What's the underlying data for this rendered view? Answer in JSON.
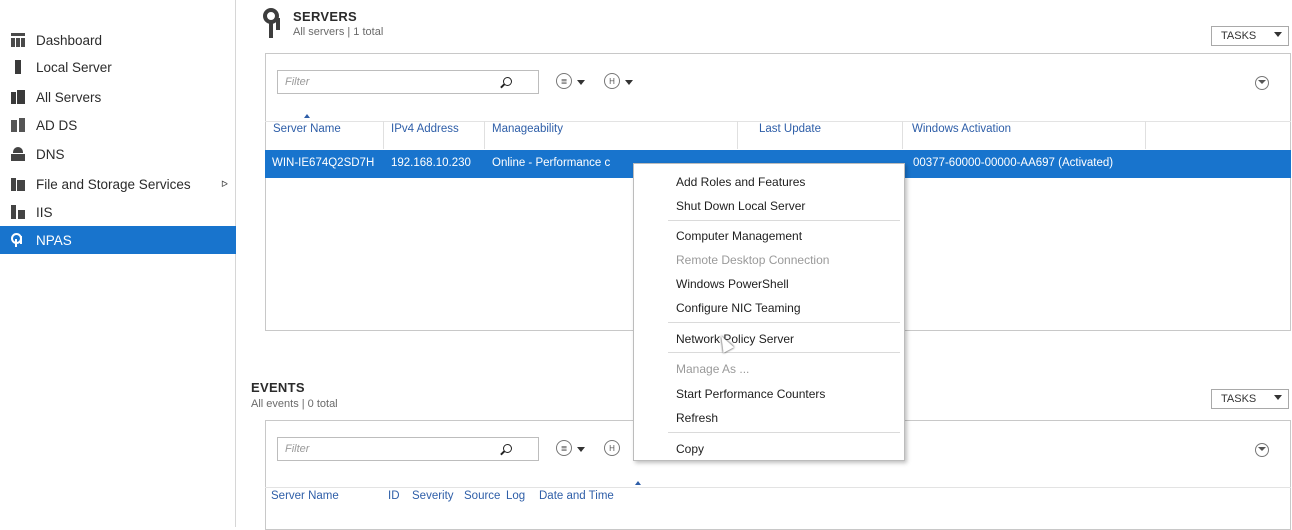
{
  "sidebar": {
    "items": [
      {
        "label": "Dashboard",
        "icon": "dashboard-icon"
      },
      {
        "label": "Local Server",
        "icon": "local-server-icon"
      },
      {
        "label": "All Servers",
        "icon": "all-servers-icon"
      },
      {
        "label": "AD DS",
        "icon": "ad-ds-icon"
      },
      {
        "label": "DNS",
        "icon": "dns-icon"
      },
      {
        "label": "File and Storage Services",
        "icon": "file-storage-icon"
      },
      {
        "label": "IIS",
        "icon": "iis-icon"
      },
      {
        "label": "NPAS",
        "icon": "npas-icon"
      }
    ],
    "selected": "NPAS",
    "expand_arrow": "ᐅ",
    "selected_color": "#1874cd"
  },
  "servers": {
    "title": "SERVERS",
    "subtitle": "All servers | 1 total",
    "tasks_label": "TASKS",
    "filter_placeholder": "Filter",
    "list_btn_glyph": "≣",
    "group_btn_glyph": "H",
    "columns": [
      "Server Name",
      "IPv4 Address",
      "Manageability",
      "Last Update",
      "Windows Activation"
    ],
    "rows": [
      {
        "server_name": "WIN-IE674Q2SD7H",
        "ipv4": "192.168.10.230",
        "manageability": "Online - Performance c",
        "last_update": "",
        "activation": "00377-60000-00000-AA697 (Activated)"
      }
    ]
  },
  "events": {
    "title": "EVENTS",
    "subtitle": "All events | 0 total",
    "tasks_label": "TASKS",
    "filter_placeholder": "Filter",
    "list_btn_glyph": "≣",
    "group_btn_glyph": "H",
    "columns": [
      "Server Name",
      "ID",
      "Severity",
      "Source",
      "Log",
      "Date and Time"
    ]
  },
  "context_menu": {
    "items": [
      {
        "label": "Add Roles and Features",
        "enabled": true
      },
      {
        "label": "Shut Down Local Server",
        "enabled": true
      },
      {
        "label": "Computer Management",
        "enabled": true
      },
      {
        "label": "Remote Desktop Connection",
        "enabled": false
      },
      {
        "label": "Windows PowerShell",
        "enabled": true
      },
      {
        "label": "Configure NIC Teaming",
        "enabled": true
      },
      {
        "label": "Network Policy Server",
        "enabled": true,
        "hovered": true
      },
      {
        "label": "Manage As ...",
        "enabled": false
      },
      {
        "label": "Start Performance Counters",
        "enabled": true
      },
      {
        "label": "Refresh",
        "enabled": true
      },
      {
        "label": "Copy",
        "enabled": true
      }
    ]
  }
}
